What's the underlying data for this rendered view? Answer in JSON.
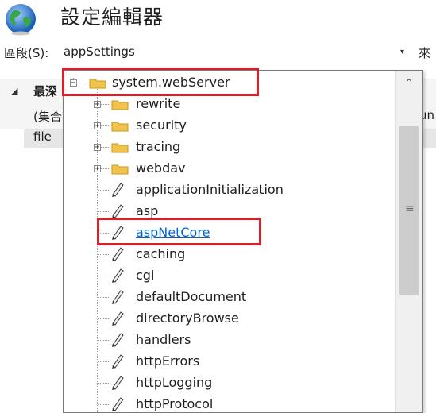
{
  "header": {
    "title": "設定編輯器",
    "icon": "globe-icon"
  },
  "section": {
    "label": "區段(S):",
    "value": "appSettings",
    "from_label": "來",
    "arrow": "▾"
  },
  "grid": {
    "expander": "◢",
    "name_header": "最深",
    "collection_text": "(集合",
    "row_key": "file",
    "right_text": "un"
  },
  "tree": {
    "root": {
      "label": "system.webServer",
      "expander": "−"
    },
    "children": [
      {
        "label": "rewrite",
        "type": "folder",
        "expander": "+"
      },
      {
        "label": "security",
        "type": "folder",
        "expander": "+"
      },
      {
        "label": "tracing",
        "type": "folder",
        "expander": "+"
      },
      {
        "label": "webdav",
        "type": "folder",
        "expander": "+"
      },
      {
        "label": "applicationInitialization",
        "type": "item"
      },
      {
        "label": "asp",
        "type": "item"
      },
      {
        "label": "aspNetCore",
        "type": "item",
        "selected": true
      },
      {
        "label": "caching",
        "type": "item"
      },
      {
        "label": "cgi",
        "type": "item"
      },
      {
        "label": "defaultDocument",
        "type": "item"
      },
      {
        "label": "directoryBrowse",
        "type": "item"
      },
      {
        "label": "handlers",
        "type": "item"
      },
      {
        "label": "httpErrors",
        "type": "item"
      },
      {
        "label": "httpLogging",
        "type": "item"
      },
      {
        "label": "httpProtocol",
        "type": "item"
      }
    ]
  },
  "scrollbar": {
    "up_arrow": "⌃",
    "grip": "≡"
  },
  "colors": {
    "highlight": "#d9202a",
    "link": "#0066cc",
    "folder": "#f2c24b"
  }
}
